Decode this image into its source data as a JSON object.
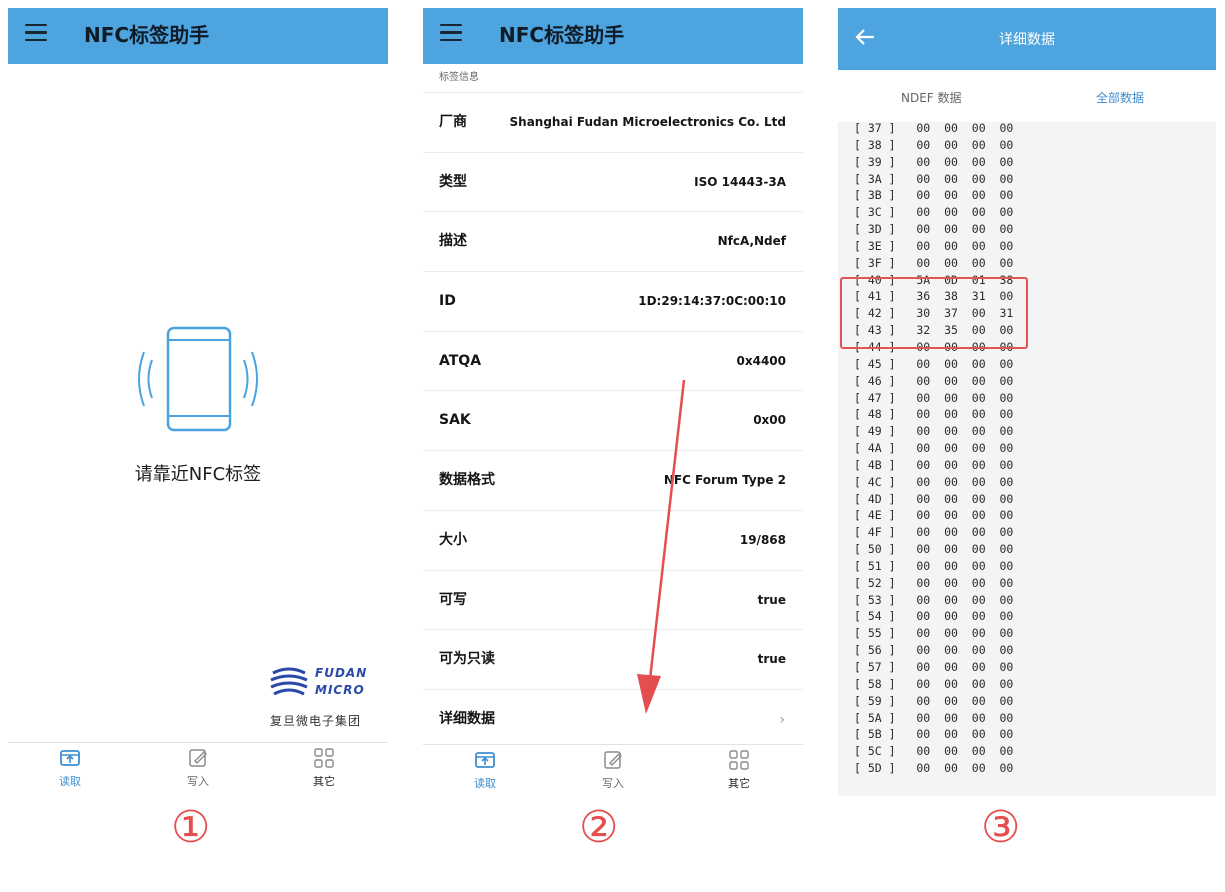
{
  "screen1": {
    "app_title": "NFC标签助手",
    "prompt": "请靠近NFC标签",
    "logo_text": "复旦微电子集团",
    "logo_word1": "FUDAN",
    "logo_word2": "MICRO",
    "tabs": [
      {
        "label": "读取",
        "icon": "nfc-read-icon"
      },
      {
        "label": "写入",
        "icon": "edit-icon"
      },
      {
        "label": "其它",
        "icon": "grid-icon"
      }
    ]
  },
  "screen2": {
    "app_title": "NFC标签助手",
    "section_header": "标签信息",
    "rows": [
      {
        "key": "厂商",
        "value": "Shanghai Fudan Microelectronics Co. Ltd"
      },
      {
        "key": "类型",
        "value": "ISO 14443-3A"
      },
      {
        "key": "描述",
        "value": "NfcA,Ndef"
      },
      {
        "key": "ID",
        "value": "1D:29:14:37:0C:00:10"
      },
      {
        "key": "ATQA",
        "value": "0x4400"
      },
      {
        "key": "SAK",
        "value": "0x00"
      },
      {
        "key": "数据格式",
        "value": "NFC Forum Type 2"
      },
      {
        "key": "大小",
        "value": "19/868"
      },
      {
        "key": "可写",
        "value": "true"
      },
      {
        "key": "可为只读",
        "value": "true"
      },
      {
        "key": "详细数据",
        "value": ""
      }
    ],
    "chevron": "›",
    "tabs": [
      {
        "label": "读取",
        "icon": "nfc-read-icon"
      },
      {
        "label": "写入",
        "icon": "edit-icon"
      },
      {
        "label": "其它",
        "icon": "grid-icon"
      }
    ]
  },
  "screen3": {
    "title": "详细数据",
    "tab_ndef": "NDEF 数据",
    "tab_all": "全部数据",
    "dump": [
      [
        "37",
        "00",
        "00",
        "00",
        "00"
      ],
      [
        "38",
        "00",
        "00",
        "00",
        "00"
      ],
      [
        "39",
        "00",
        "00",
        "00",
        "00"
      ],
      [
        "3A",
        "00",
        "00",
        "00",
        "00"
      ],
      [
        "3B",
        "00",
        "00",
        "00",
        "00"
      ],
      [
        "3C",
        "00",
        "00",
        "00",
        "00"
      ],
      [
        "3D",
        "00",
        "00",
        "00",
        "00"
      ],
      [
        "3E",
        "00",
        "00",
        "00",
        "00"
      ],
      [
        "3F",
        "00",
        "00",
        "00",
        "00"
      ],
      [
        "40",
        "5A",
        "0D",
        "01",
        "38"
      ],
      [
        "41",
        "36",
        "38",
        "31",
        "00"
      ],
      [
        "42",
        "30",
        "37",
        "00",
        "31"
      ],
      [
        "43",
        "32",
        "35",
        "00",
        "00"
      ],
      [
        "44",
        "00",
        "00",
        "00",
        "00"
      ],
      [
        "45",
        "00",
        "00",
        "00",
        "00"
      ],
      [
        "46",
        "00",
        "00",
        "00",
        "00"
      ],
      [
        "47",
        "00",
        "00",
        "00",
        "00"
      ],
      [
        "48",
        "00",
        "00",
        "00",
        "00"
      ],
      [
        "49",
        "00",
        "00",
        "00",
        "00"
      ],
      [
        "4A",
        "00",
        "00",
        "00",
        "00"
      ],
      [
        "4B",
        "00",
        "00",
        "00",
        "00"
      ],
      [
        "4C",
        "00",
        "00",
        "00",
        "00"
      ],
      [
        "4D",
        "00",
        "00",
        "00",
        "00"
      ],
      [
        "4E",
        "00",
        "00",
        "00",
        "00"
      ],
      [
        "4F",
        "00",
        "00",
        "00",
        "00"
      ],
      [
        "50",
        "00",
        "00",
        "00",
        "00"
      ],
      [
        "51",
        "00",
        "00",
        "00",
        "00"
      ],
      [
        "52",
        "00",
        "00",
        "00",
        "00"
      ],
      [
        "53",
        "00",
        "00",
        "00",
        "00"
      ],
      [
        "54",
        "00",
        "00",
        "00",
        "00"
      ],
      [
        "55",
        "00",
        "00",
        "00",
        "00"
      ],
      [
        "56",
        "00",
        "00",
        "00",
        "00"
      ],
      [
        "57",
        "00",
        "00",
        "00",
        "00"
      ],
      [
        "58",
        "00",
        "00",
        "00",
        "00"
      ],
      [
        "59",
        "00",
        "00",
        "00",
        "00"
      ],
      [
        "5A",
        "00",
        "00",
        "00",
        "00"
      ],
      [
        "5B",
        "00",
        "00",
        "00",
        "00"
      ],
      [
        "5C",
        "00",
        "00",
        "00",
        "00"
      ],
      [
        "5D",
        "00",
        "00",
        "00",
        "00"
      ]
    ]
  },
  "step_labels": [
    "①",
    "②",
    "③"
  ],
  "colors": {
    "appbar": "#4ea4df",
    "tab_active": "#3d8ed1",
    "annotation_red": "#e54e4e"
  }
}
